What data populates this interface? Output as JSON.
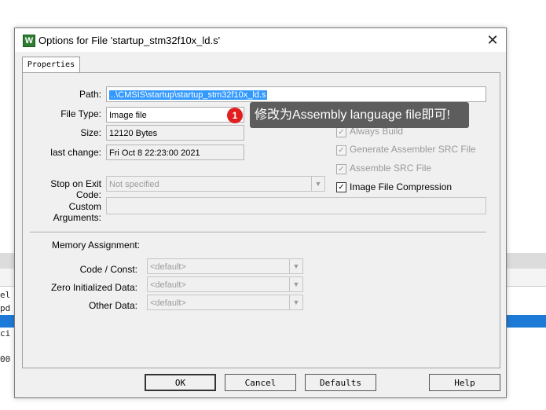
{
  "background": {
    "left_snippets": [
      "el",
      "pd",
      "ci",
      "00"
    ],
    "accent_color": "#1e7ad7"
  },
  "dialog": {
    "title": "Options for File 'startup_stm32f10x_ld.s'",
    "close_glyph": "✕",
    "app_icon": "keil-uvision-icon",
    "tab_label": "Properties",
    "fields": {
      "path_label": "Path:",
      "path_value": "..\\CMSIS\\startup\\startup_stm32f10x_ld.s",
      "file_type_label": "File Type:",
      "file_type_value": "Image file",
      "size_label": "Size:",
      "size_value": "12120 Bytes",
      "last_change_label": "last change:",
      "last_change_value": "Fri Oct  8 22:23:00 2021",
      "stop_exit_label": "Stop on Exit Code:",
      "stop_exit_value": "Not specified",
      "custom_args_label": "Custom Arguments:",
      "custom_args_value": ""
    },
    "checkboxes": [
      {
        "label": "Always Build",
        "checked": true,
        "disabled": true
      },
      {
        "label": "Generate Assembler SRC File",
        "checked": true,
        "disabled": true
      },
      {
        "label": "Assemble SRC File",
        "checked": true,
        "disabled": true
      },
      {
        "label": "Image File Compression",
        "checked": true,
        "disabled": false
      }
    ],
    "memory": {
      "section_label": "Memory Assignment:",
      "code_const_label": "Code / Const:",
      "code_const_value": "<default>",
      "zero_init_label": "Zero Initialized Data:",
      "zero_init_value": "<default>",
      "other_data_label": "Other Data:",
      "other_data_value": "<default>"
    },
    "buttons": {
      "ok": "OK",
      "cancel": "Cancel",
      "defaults": "Defaults",
      "help": "Help"
    }
  },
  "annotation": {
    "badge": "1",
    "text": "修改为Assembly language file即可!"
  }
}
